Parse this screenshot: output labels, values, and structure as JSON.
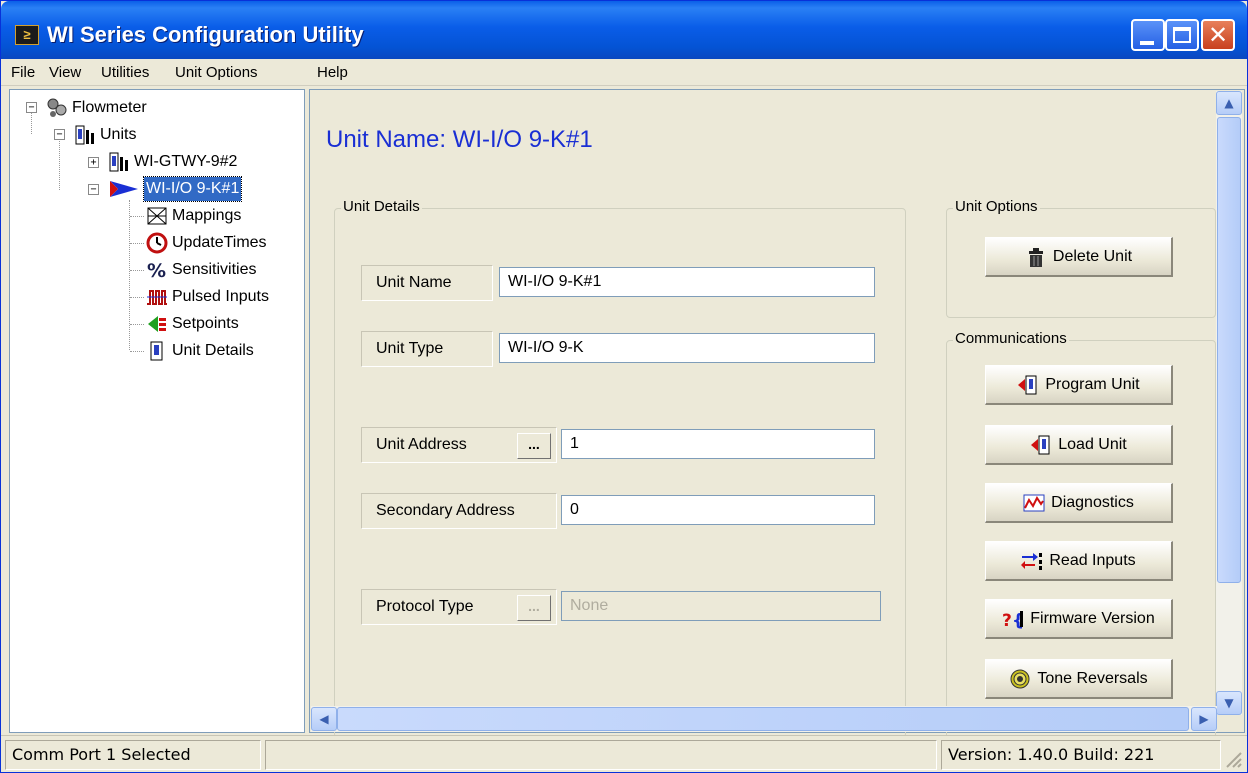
{
  "window": {
    "title": "WI Series Configuration Utility",
    "app_icon_glyph": "≥"
  },
  "menu": [
    "File",
    "View",
    "Utilities",
    "Unit Options",
    "Help"
  ],
  "tree": {
    "root": "Flowmeter",
    "units_label": "Units",
    "gateway": "WI-GTWY-9#2",
    "selected_unit": "WI-I/O 9-K#1",
    "children": [
      {
        "label": "Mappings",
        "icon": "mappings-icon"
      },
      {
        "label": "UpdateTimes",
        "icon": "clock-icon"
      },
      {
        "label": "Sensitivities",
        "icon": "percent-icon"
      },
      {
        "label": "Pulsed Inputs",
        "icon": "pulse-icon"
      },
      {
        "label": "Setpoints",
        "icon": "setpoints-icon"
      },
      {
        "label": "Unit Details",
        "icon": "unit-details-icon"
      }
    ]
  },
  "main": {
    "heading": "Unit Name: WI-I/O 9-K#1",
    "unit_details": {
      "title": "Unit Details",
      "unit_name_label": "Unit Name",
      "unit_name_value": "WI-I/O 9-K#1",
      "unit_type_label": "Unit Type",
      "unit_type_value": "WI-I/O 9-K",
      "unit_address_label": "Unit Address",
      "unit_address_value": "1",
      "secondary_address_label": "Secondary Address",
      "secondary_address_value": "0",
      "protocol_type_label": "Protocol Type",
      "protocol_type_value": "None",
      "ellipsis": "..."
    },
    "unit_options": {
      "title": "Unit Options",
      "delete_label": "Delete Unit"
    },
    "communications": {
      "title": "Communications",
      "buttons": [
        {
          "label": "Program Unit",
          "icon": "program-unit-icon"
        },
        {
          "label": "Load Unit",
          "icon": "load-unit-icon"
        },
        {
          "label": "Diagnostics",
          "icon": "diagnostics-icon"
        },
        {
          "label": "Read Inputs",
          "icon": "read-inputs-icon"
        },
        {
          "label": "Firmware Version",
          "icon": "firmware-icon"
        },
        {
          "label": "Tone Reversals",
          "icon": "tone-icon"
        }
      ]
    }
  },
  "status": {
    "left": "Comm Port 1 Selected",
    "middle": "",
    "right": "Version: 1.40.0 Build: 221"
  },
  "colors": {
    "title_blue": "#0a5de8",
    "heading_blue": "#1a2fd4",
    "selection": "#316ac5",
    "face": "#ece9d8"
  }
}
